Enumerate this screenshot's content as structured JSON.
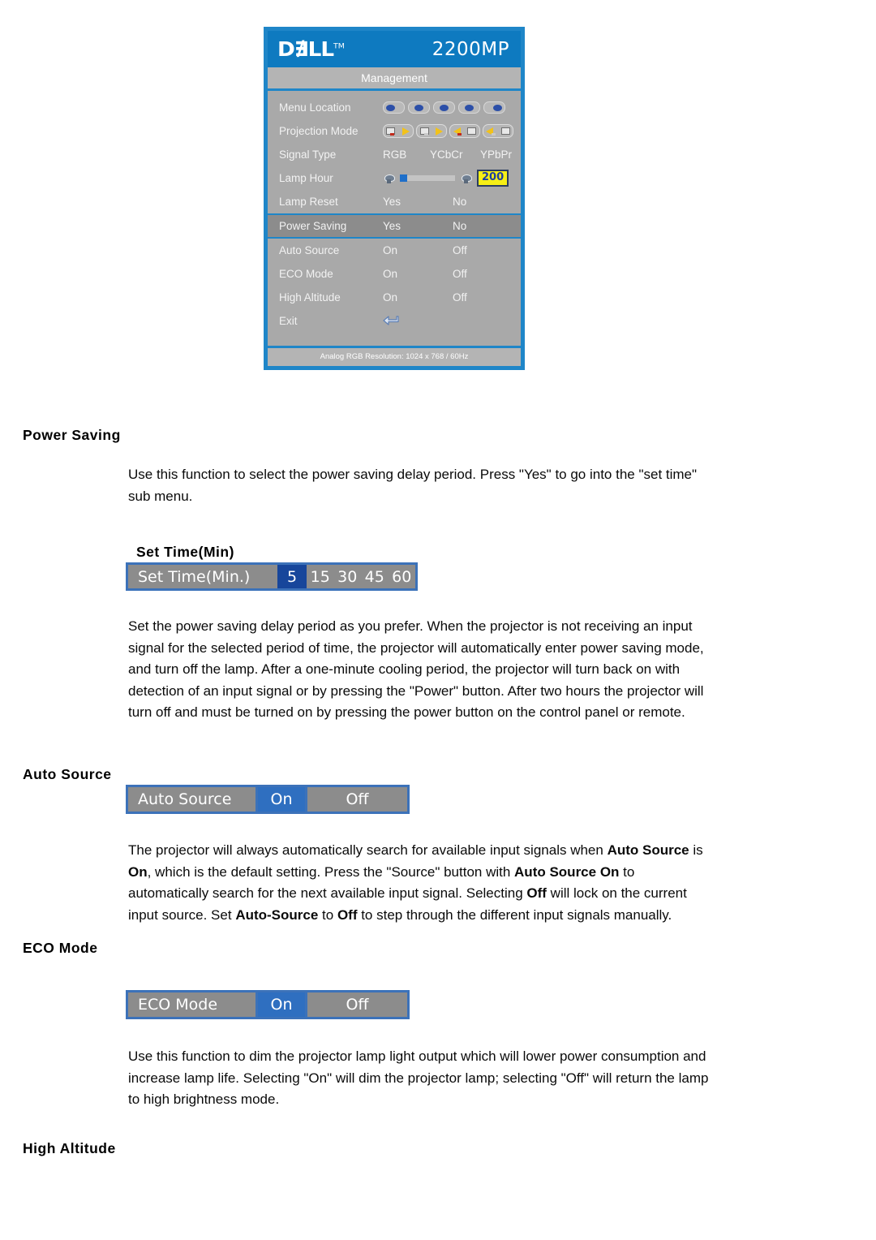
{
  "osd": {
    "brand": "D∄LL",
    "brand_tm": "TM",
    "model": "2200MP",
    "subtitle": "Management",
    "footer": "Analog RGB Resolution: 1024 x 768 / 60Hz",
    "accent_blue": "#1f86c8",
    "title_blue": "#0e7ac0",
    "panel_gray": "#a9a9a9",
    "highlight_gray": "#8c8c8c",
    "rows": [
      {
        "label": "Menu Location",
        "type": "locations"
      },
      {
        "label": "Projection Mode",
        "type": "projection"
      },
      {
        "label": "Signal Type",
        "type": "options3",
        "opt1": "RGB",
        "opt2": "YCbCr",
        "opt3": "YPbPr"
      },
      {
        "label": "Lamp Hour",
        "type": "lamp",
        "value": "200"
      },
      {
        "label": "Lamp Reset",
        "type": "options2",
        "opt1": "Yes",
        "opt2": "No"
      },
      {
        "label": "Power Saving",
        "type": "options2",
        "opt1": "Yes",
        "opt2": "No",
        "highlight": true
      },
      {
        "label": "Auto Source",
        "type": "options2",
        "opt1": "On",
        "opt2": "Off"
      },
      {
        "label": "ECO Mode",
        "type": "options2",
        "opt1": "On",
        "opt2": "Off"
      },
      {
        "label": "High Altitude",
        "type": "options2",
        "opt1": "On",
        "opt2": "Off"
      },
      {
        "label": "Exit",
        "type": "exit"
      }
    ]
  },
  "sections": {
    "power_saving": {
      "heading": "Power Saving",
      "body": "Use this function to select the power saving delay period. Press \"Yes\" to go into the \"set time\" sub menu."
    },
    "set_time": {
      "heading": "Set Time(Min)",
      "widget": {
        "label": "Set Time(Min.)",
        "options": [
          "5",
          "15",
          "30",
          "45",
          "60"
        ],
        "selected": "5"
      },
      "body": "Set the power saving delay period as you prefer. When the projector is not receiving an input signal for the selected period of time, the projector will automatically enter power saving mode, and turn off the lamp. After a one-minute cooling period, the projector will turn back on with detection of an input signal or by pressing the \"Power\" button. After two hours the projector will turn off and must be turned on by pressing the power button on the control panel or remote."
    },
    "auto_source": {
      "heading": "Auto Source",
      "widget": {
        "label": "Auto Source",
        "on": "On",
        "off": "Off",
        "selected": "On"
      },
      "body_parts": [
        {
          "t": "The projector will always automatically search for available input signals when ",
          "b": false
        },
        {
          "t": "Auto Source",
          "b": true
        },
        {
          "t": " is ",
          "b": false
        },
        {
          "t": "On",
          "b": true
        },
        {
          "t": ", which is the default setting. Press the \"Source\" button with ",
          "b": false
        },
        {
          "t": "Auto Source On",
          "b": true
        },
        {
          "t": " to automatically search for the next available input signal. Selecting ",
          "b": false
        },
        {
          "t": "Off",
          "b": true
        },
        {
          "t": " will lock on the current input source. Set ",
          "b": false
        },
        {
          "t": "Auto-Source",
          "b": true
        },
        {
          "t": " to ",
          "b": false
        },
        {
          "t": "Off",
          "b": true
        },
        {
          "t": " to step through the different input signals manually.",
          "b": false
        }
      ]
    },
    "eco_mode": {
      "heading": "ECO Mode",
      "widget": {
        "label": "ECO Mode",
        "on": "On",
        "off": "Off",
        "selected": "On"
      },
      "body": "Use this function to dim the projector lamp light output which will lower power consumption and increase lamp life. Selecting \"On\" will dim the projector lamp; selecting \"Off\" will return the lamp to high brightness mode."
    },
    "high_altitude": {
      "heading": "High Altitude"
    }
  }
}
